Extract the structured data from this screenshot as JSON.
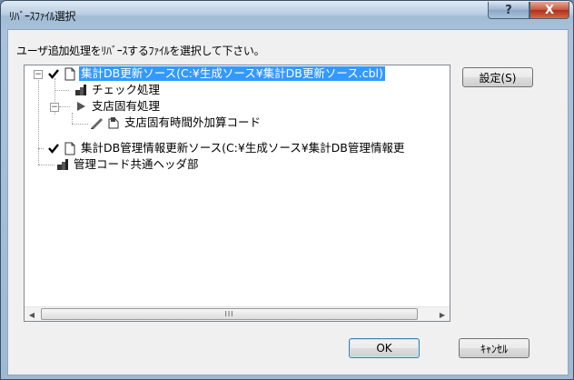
{
  "window": {
    "title": "ﾘﾊﾞｰｽﾌｧｲﾙ選択",
    "help_label": "?",
    "close_label": "X"
  },
  "prompt": "ユーザ追加処理をﾘﾊﾞｰｽするﾌｧｲﾙを選択して下さい。",
  "tree": {
    "nodes": [
      {
        "label": "集計DB更新ソース(C:¥生成ソース¥集計DB更新ソース.cbl)",
        "selected": true,
        "checked": true,
        "icon": "document-icon"
      },
      {
        "label": "チェック処理",
        "icon": "routine-icon"
      },
      {
        "label": "支店固有処理",
        "icon": "arrow-icon"
      },
      {
        "label": "支店固有時間外加算コード",
        "icon": "edit-routine-icon"
      },
      {
        "label": "集計DB管理情報更新ソース(C:¥生成ソース¥集計DB管理情報更",
        "checked": true,
        "icon": "document-icon"
      },
      {
        "label": "管理コード共通ヘッダ部",
        "icon": "routine-icon"
      }
    ],
    "expander_collapse": "−",
    "scroll_grip": "III"
  },
  "buttons": {
    "settings": "設定(S)",
    "ok": "OK",
    "cancel": "ｷｬﾝｾﾙ"
  },
  "colors": {
    "selection": "#3399ff",
    "close_button": "#c9553d"
  }
}
